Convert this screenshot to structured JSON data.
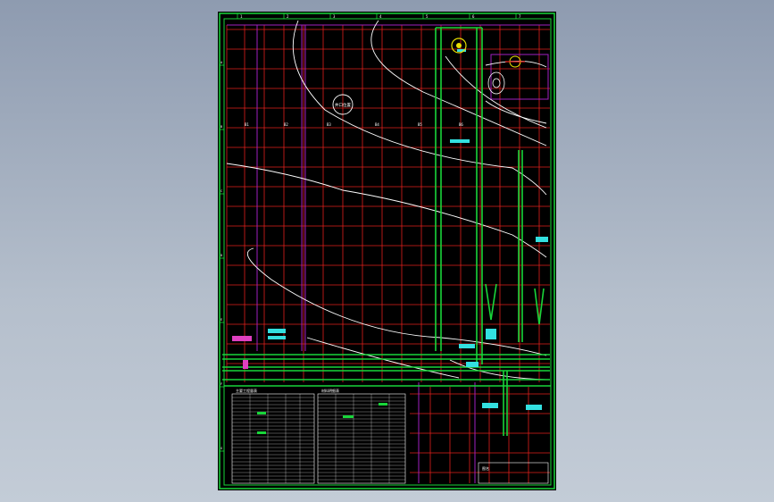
{
  "drawing": {
    "colors": {
      "grid": "#e0201c",
      "frame": "#19d63a",
      "contour": "#ffffff",
      "boundary": "#a020c0",
      "annotation": "#33e0e0",
      "highlight": "#e040c0",
      "marker": "#e8e000",
      "background": "#000000"
    },
    "top_ruler_labels": [
      "1",
      "2",
      "3",
      "4",
      "5",
      "6",
      "7"
    ],
    "left_ruler_labels": [
      "A",
      "B",
      "C",
      "D",
      "E",
      "F",
      "G"
    ],
    "row_labels": [
      "B1",
      "B2",
      "B3",
      "B4",
      "B5",
      "B6"
    ],
    "circle_label": "井口位置",
    "icons": [
      "wellhead-marker-icon",
      "valve-marker-icon",
      "spiral-curve-icon"
    ],
    "table_left_title": "主要工程量表",
    "table_right_title": "材料明细表",
    "title_block_label": "图名"
  }
}
